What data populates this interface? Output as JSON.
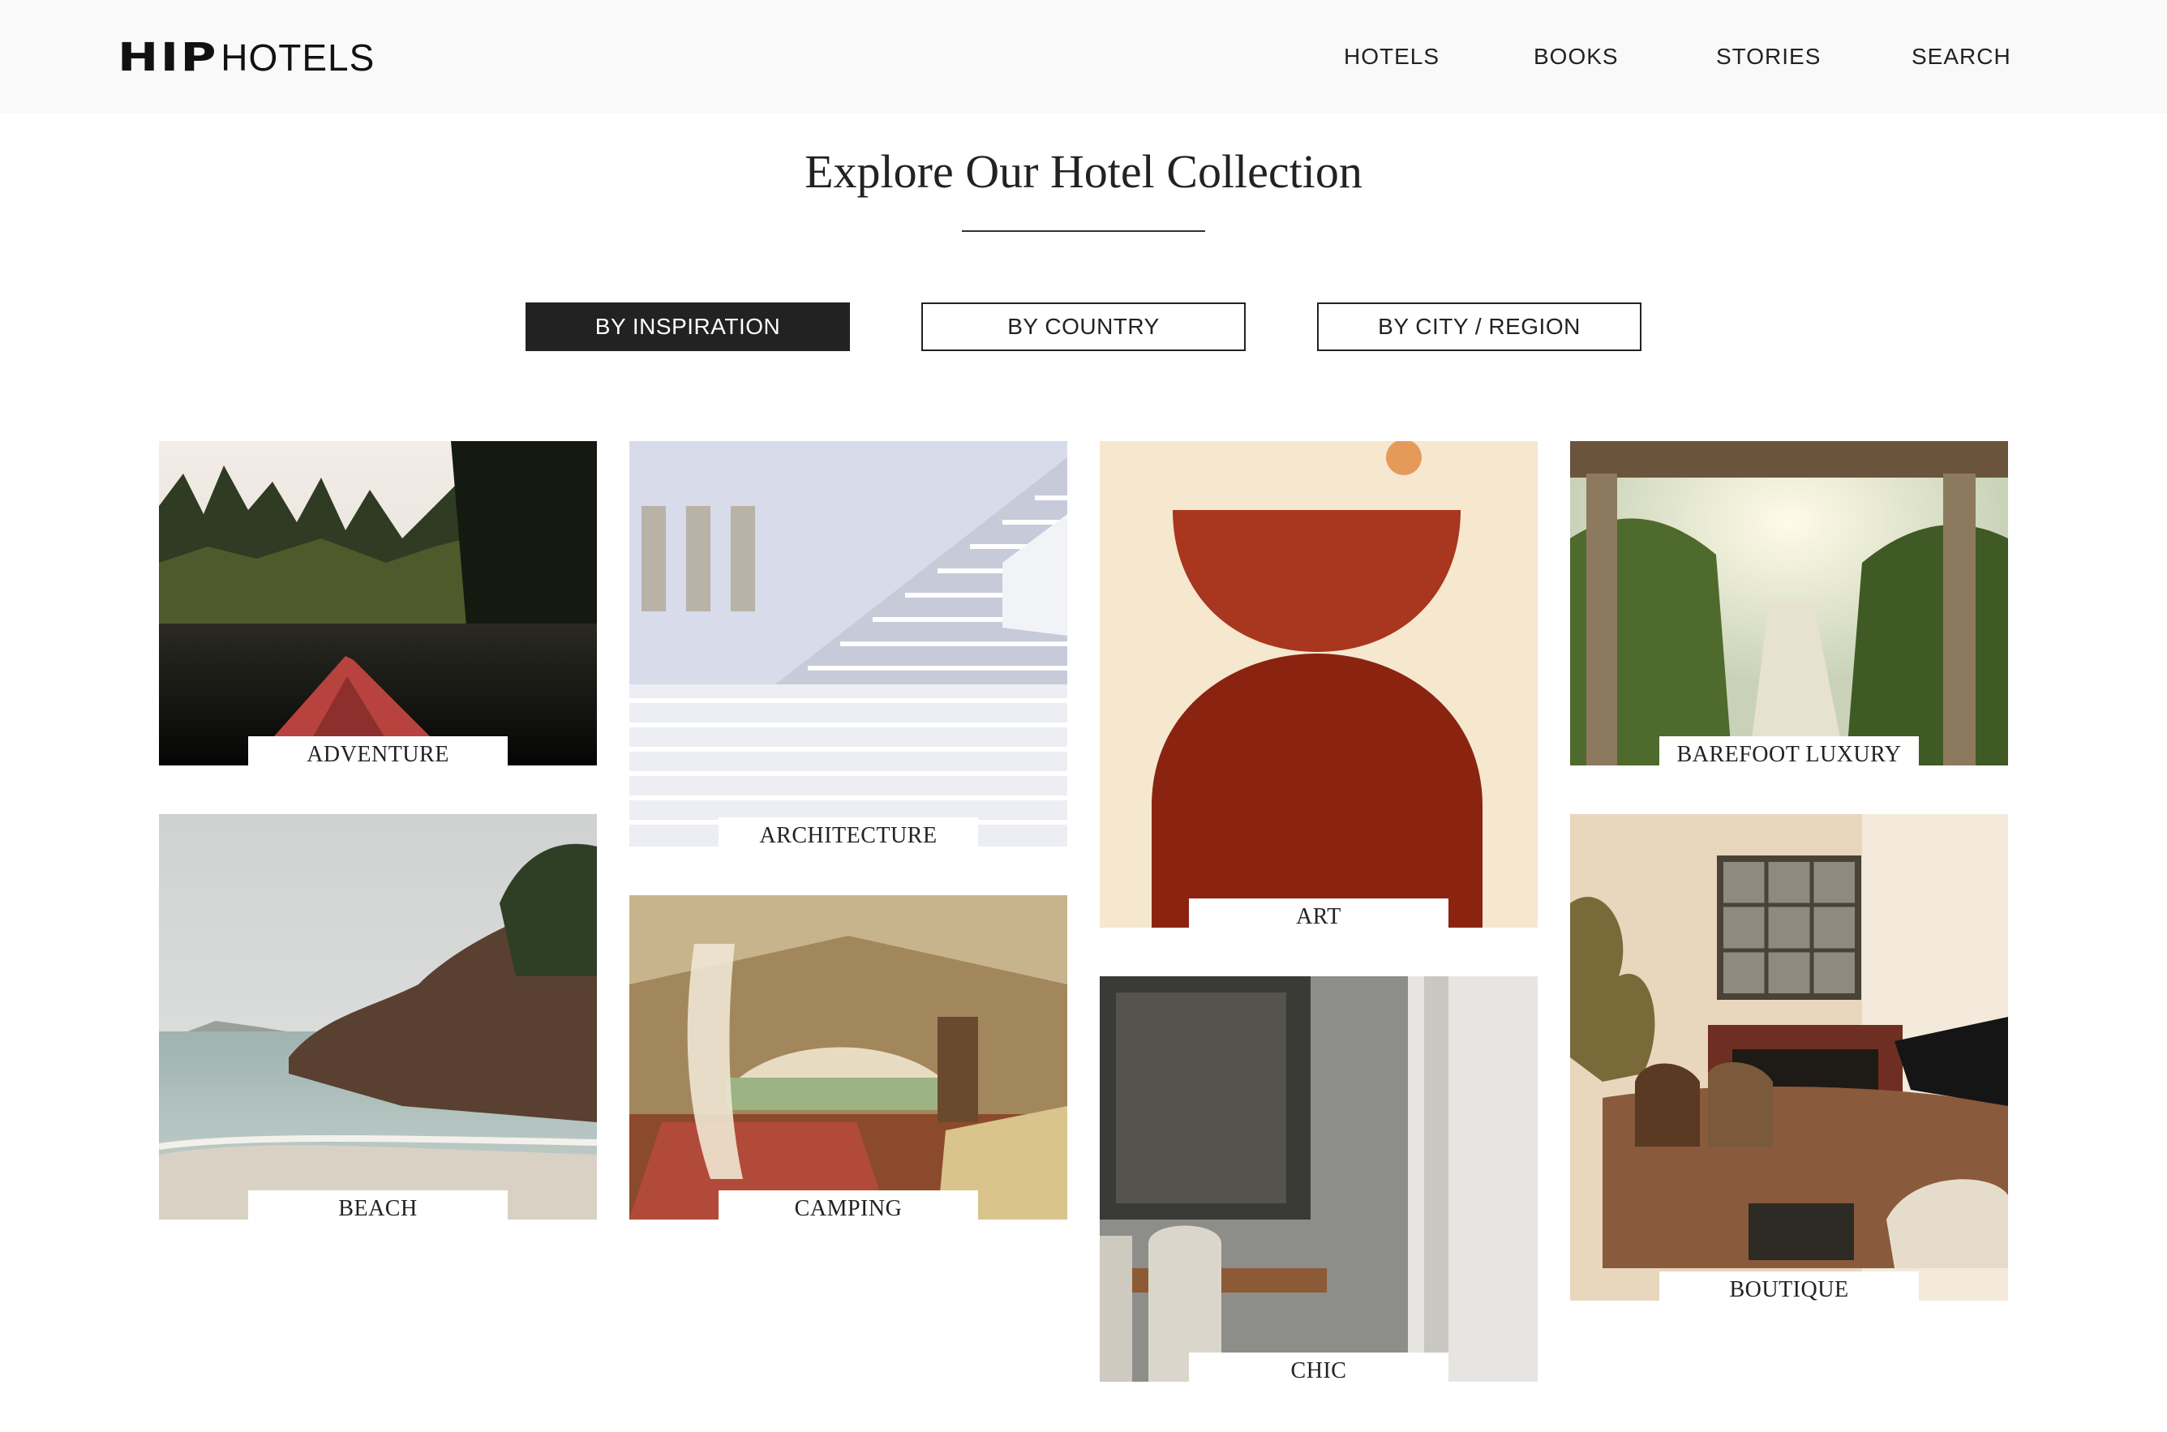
{
  "brand": {
    "logo_bold": "HIP",
    "logo_light": "HOTELS"
  },
  "nav": {
    "items": [
      "HOTELS",
      "BOOKS",
      "STORIES",
      "SEARCH"
    ]
  },
  "page": {
    "title": "Explore Our Hotel Collection"
  },
  "tabs": {
    "active": "BY INSPIRATION",
    "items": [
      "BY INSPIRATION",
      "BY COUNTRY",
      "BY CITY / REGION"
    ]
  },
  "categories": [
    {
      "label": "ADVENTURE",
      "image": "kayak-lake-photo"
    },
    {
      "label": "ARCHITECTURE",
      "image": "white-staircase-photo"
    },
    {
      "label": "ART",
      "image": "abstract-red-shapes-painting"
    },
    {
      "label": "BAREFOOT LUXURY",
      "image": "tropical-pathway-photo"
    },
    {
      "label": "BEACH",
      "image": "rocky-shore-photo"
    },
    {
      "label": "CAMPING",
      "image": "safari-tent-photo"
    },
    {
      "label": "CHIC",
      "image": "dining-room-photo"
    },
    {
      "label": "BOUTIQUE",
      "image": "lounge-interior-photo"
    }
  ],
  "colors": {
    "active_tab_bg": "#222222",
    "header_bg": "#f9f9f9",
    "text": "#222222"
  }
}
